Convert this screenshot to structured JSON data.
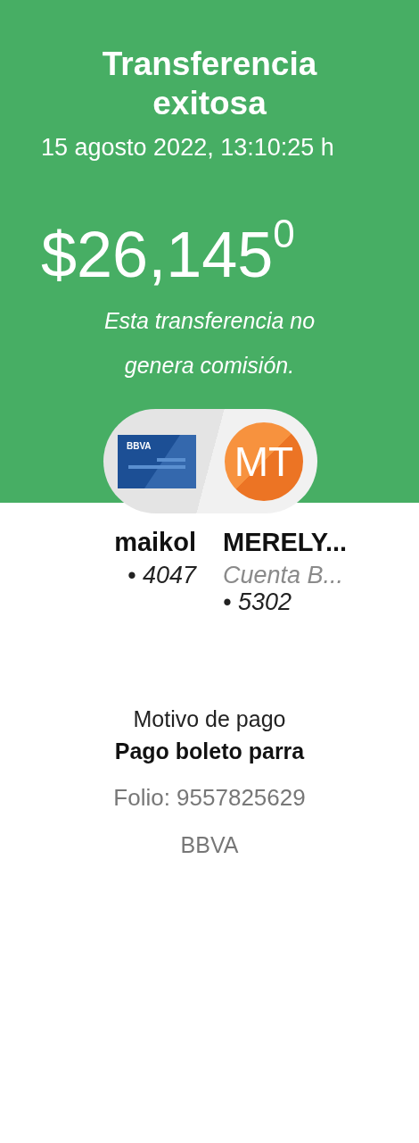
{
  "header": {
    "title": "Transferencia exitosa",
    "datetime": "15 agosto 2022, 13:10:25 h",
    "amount": "$26,145$^{0}$",
    "note": "Esta transferencia no genera comisión."
  },
  "accounts": [
    {
      "kind": "card",
      "card_label": "BBVA",
      "name": "maikol",
      "lines": [
        {
          "text": "• 4047",
          "muted": false
        }
      ]
    },
    {
      "kind": "avatar",
      "initials": "MT",
      "name": "MERELY...",
      "lines": [
        {
          "text": "Cuenta B...",
          "muted": true
        },
        {
          "text": "• 5302",
          "muted": false
        }
      ]
    }
  ],
  "details": {
    "label": "Motivo de pago",
    "concept": "Pago boleto parra",
    "folio": "Folio: 9557825629",
    "bank": "BBVA"
  }
}
